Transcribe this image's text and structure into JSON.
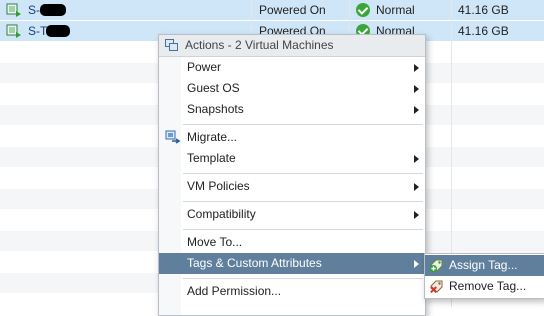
{
  "vm_table": {
    "rows": [
      {
        "name": "S-",
        "state": "Powered On",
        "status": "Normal",
        "size": "41.16  GB"
      },
      {
        "name": "S-T",
        "state": "Powered On",
        "status": "Normal",
        "size": "41.16  GB"
      }
    ]
  },
  "context_menu": {
    "header": "Actions - 2 Virtual Machines",
    "items": [
      {
        "label": "Power"
      },
      {
        "label": "Guest OS"
      },
      {
        "label": "Snapshots"
      },
      {
        "label": "Migrate..."
      },
      {
        "label": "Template"
      },
      {
        "label": "VM Policies"
      },
      {
        "label": "Compatibility"
      },
      {
        "label": "Move To..."
      },
      {
        "label": "Tags & Custom Attributes"
      },
      {
        "label": "Add Permission..."
      }
    ]
  },
  "submenu": {
    "items": [
      {
        "label": "Assign Tag..."
      },
      {
        "label": "Remove Tag..."
      }
    ]
  },
  "colors": {
    "selection_row": "#cfe6f8",
    "menu_highlight": "#5f7f9c",
    "status_ok": "#3aa63a"
  }
}
